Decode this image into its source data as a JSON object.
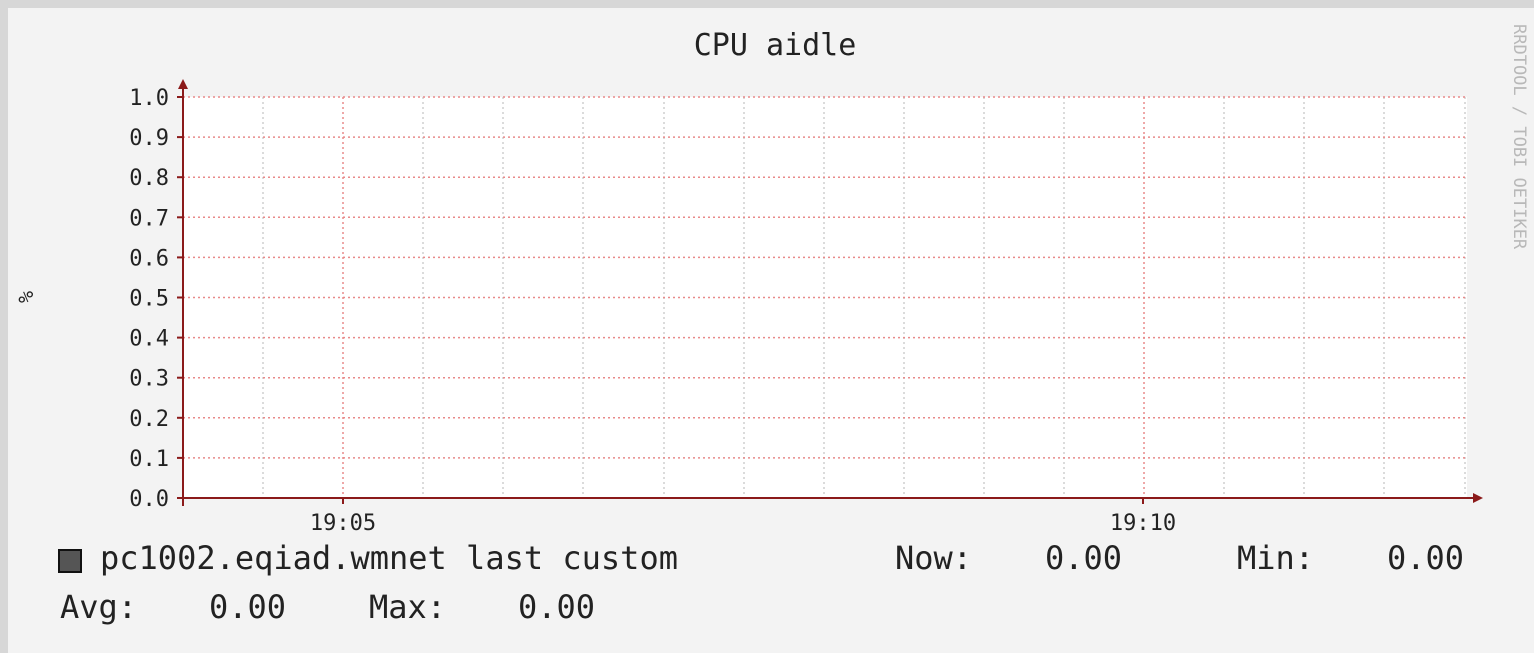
{
  "chart_data": {
    "type": "line",
    "title": "CPU aidle",
    "ylabel": "%",
    "xlabel": "",
    "watermark": "RRDTOOL / TOBI OETIKER",
    "ylim": [
      0.0,
      1.0
    ],
    "y_ticks": [
      "0.0",
      "0.1",
      "0.2",
      "0.3",
      "0.4",
      "0.5",
      "0.6",
      "0.7",
      "0.8",
      "0.9",
      "1.0"
    ],
    "x_tick_labels": [
      "19:05",
      "19:10"
    ],
    "series": [
      {
        "name": "pc1002.eqiad.wmnet last custom",
        "values": [],
        "color": "#555555"
      }
    ],
    "grid": true,
    "legend_position": "bottom"
  },
  "colors": {
    "background": "#f3f3f3",
    "canvas": "#ffffff",
    "major_grid": "#e88a8a",
    "minor_grid": "#cfcfcf",
    "axis": "#8b1a1a",
    "text": "#222222"
  },
  "legend": {
    "series_label": "pc1002.eqiad.wmnet last custom",
    "now_label": "Now:",
    "now_value": "0.00",
    "min_label": "Min:",
    "min_value": "0.00",
    "avg_label": "Avg:",
    "avg_value": "0.00",
    "max_label": "Max:",
    "max_value": "0.00"
  }
}
